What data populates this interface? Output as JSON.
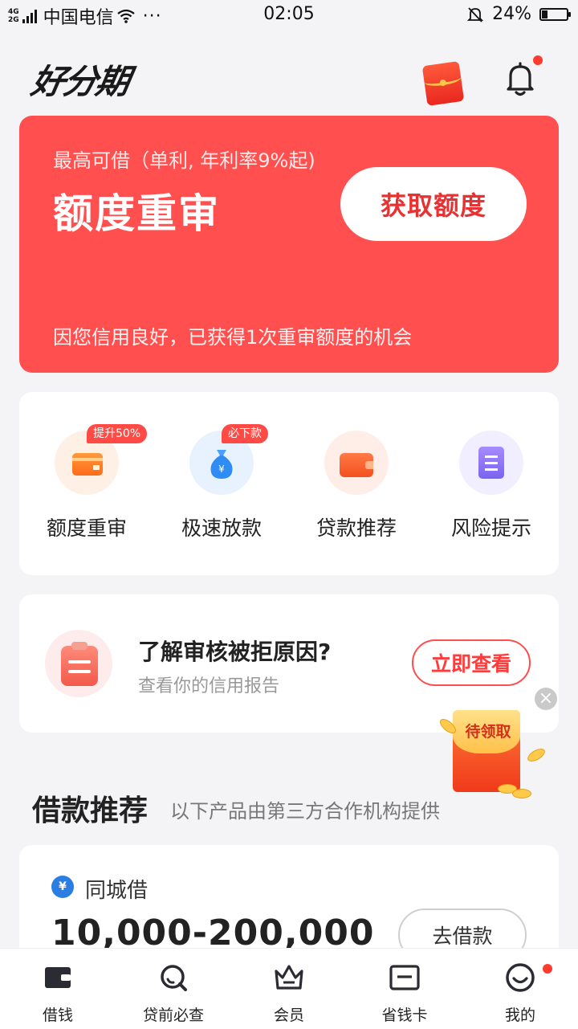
{
  "status_bar": {
    "network": [
      "4G",
      "2G"
    ],
    "carrier": "中国电信",
    "more": "···",
    "time": "02:05",
    "battery_percent": "24%",
    "battery_level": 0.24
  },
  "header": {
    "logo_text": "好分期"
  },
  "hero": {
    "subtitle": "最高可借（单利, 年利率9%起)",
    "title": "额度重审",
    "cta_label": "获取额度",
    "footnote": "因您信用良好，已获得1次重审额度的机会",
    "bg_color": "#ff4f4f"
  },
  "quick_actions": [
    {
      "label": "额度重审",
      "badge": "提升50%",
      "icon": "wallet-icon"
    },
    {
      "label": "极速放款",
      "badge": "必下款",
      "icon": "money-bag-icon"
    },
    {
      "label": "贷款推荐",
      "badge": "",
      "icon": "card-wallet-icon"
    },
    {
      "label": "风险提示",
      "badge": "",
      "icon": "document-icon"
    }
  ],
  "reason_card": {
    "title": "了解审核被拒原因?",
    "subtitle": "查看你的信用报告",
    "button_label": "立即查看"
  },
  "promo": {
    "label": "待领取",
    "close": "×"
  },
  "section": {
    "title": "借款推荐",
    "subtitle": "以下产品由第三方合作机构提供"
  },
  "product": {
    "logo_glyph": "¥",
    "name": "同城借",
    "amount": "10,000-200,000",
    "button_label": "去借款"
  },
  "tabs": [
    {
      "label": "借钱",
      "icon": "wallet-tab-icon"
    },
    {
      "label": "贷前必查",
      "icon": "search-tab-icon"
    },
    {
      "label": "会员",
      "icon": "crown-icon"
    },
    {
      "label": "省钱卡",
      "icon": "card-tab-icon"
    },
    {
      "label": "我的",
      "icon": "profile-icon"
    }
  ],
  "colors": {
    "accent": "#ff4f4f",
    "background": "#f4f4f6"
  }
}
